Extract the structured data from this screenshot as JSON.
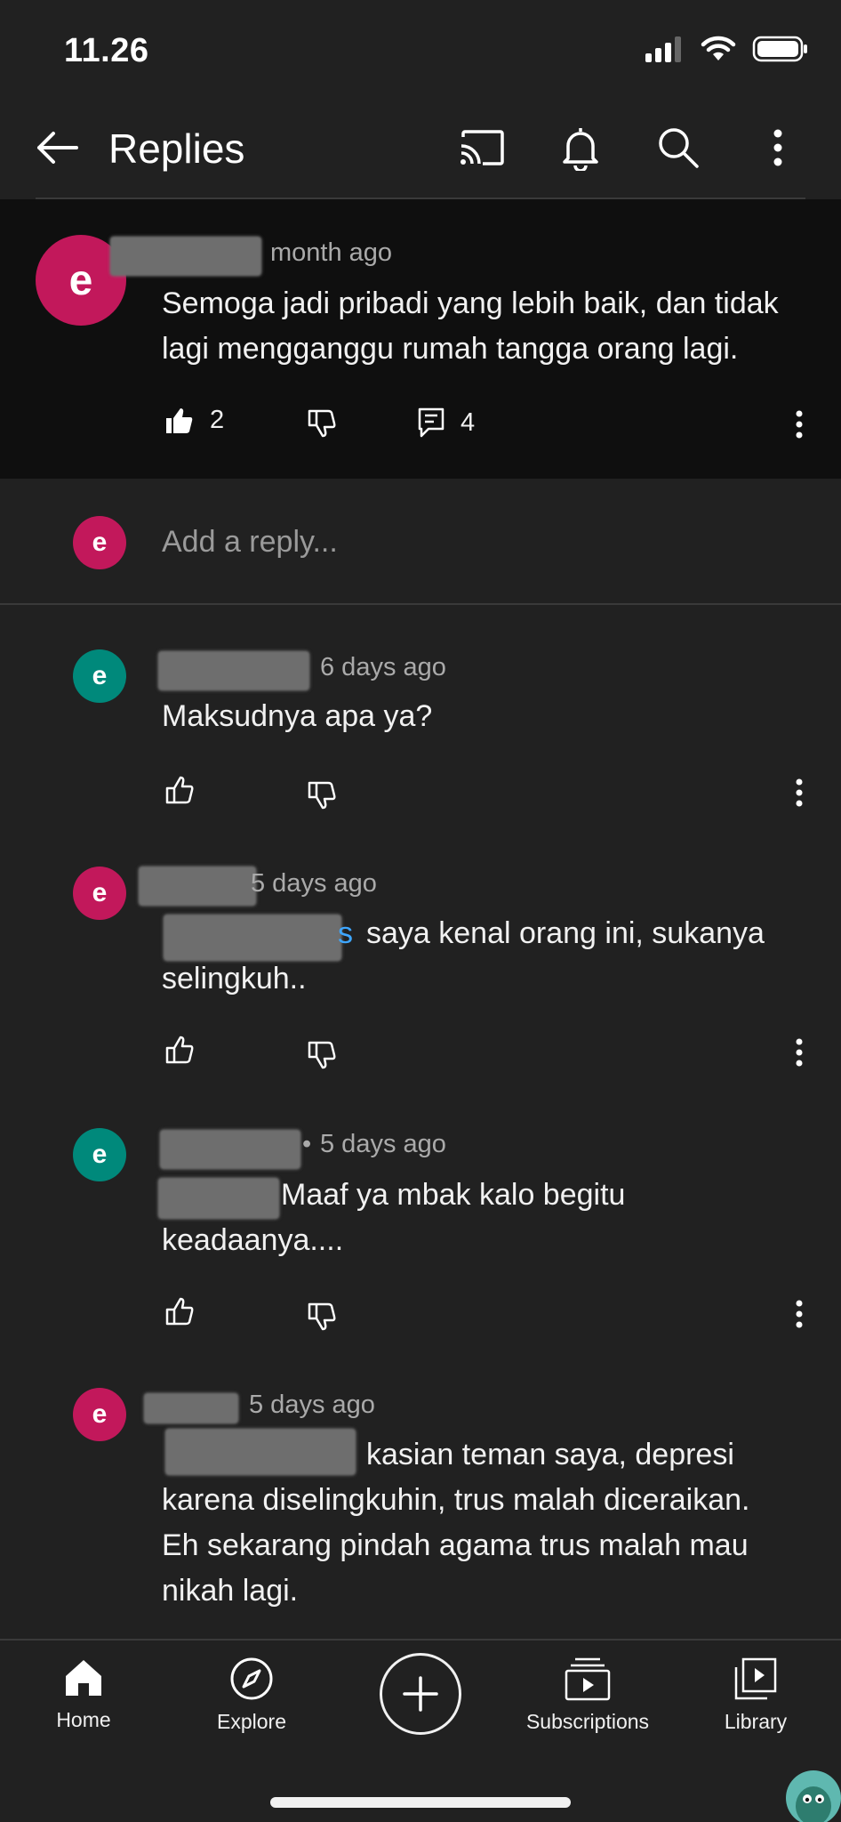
{
  "status_bar": {
    "time": "11.26"
  },
  "header": {
    "title": "Replies"
  },
  "parent_comment": {
    "avatar_letter": "e",
    "timestamp": "month ago",
    "text_line1": "Semoga jadi pribadi yang lebih baik, dan tidak",
    "text_line2": "lagi mengganggu rumah tangga orang lagi.",
    "like_count": "2",
    "reply_count": "4"
  },
  "reply_box": {
    "avatar_letter": "e",
    "placeholder": "Add a reply..."
  },
  "replies": [
    {
      "avatar_letter": "e",
      "timestamp": "6 days ago",
      "line1": "Maksudnya apa ya?"
    },
    {
      "avatar_letter": "e",
      "timestamp": "5 days ago",
      "mention_tail": "s",
      "line1": "saya kenal orang ini, sukanya",
      "line2": "selingkuh.."
    },
    {
      "avatar_letter": "e",
      "separator": "•",
      "timestamp": "5 days ago",
      "line1": "Maaf ya mbak kalo begitu",
      "line2": "keadaanya...."
    },
    {
      "avatar_letter": "e",
      "timestamp": "5 days ago",
      "line1": "kasian teman saya, depresi",
      "line2": "karena diselingkuhin, trus malah diceraikan.",
      "line3": "Eh sekarang pindah agama trus malah mau",
      "line4": "nikah lagi."
    }
  ],
  "bottom_nav": {
    "home": "Home",
    "explore": "Explore",
    "subscriptions": "Subscriptions",
    "library": "Library"
  },
  "colors": {
    "background": "#212121",
    "parent_bg": "#0f0f0f",
    "avatar_pink": "#c2185b",
    "avatar_teal": "#00897b",
    "mention": "#3ea6ff"
  }
}
